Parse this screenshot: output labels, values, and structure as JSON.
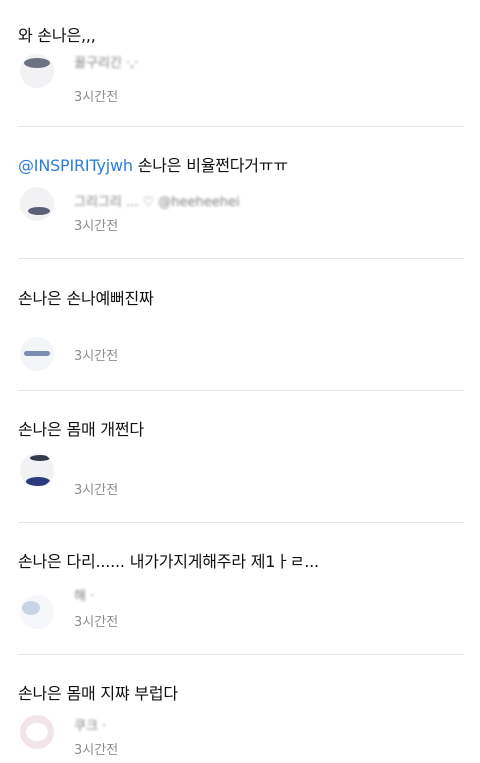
{
  "posts": [
    {
      "body": "와 손나은,,,",
      "username": "꿀구리긴 ·,·",
      "time": "3시간전"
    },
    {
      "mention": "@INSPIRITyjwh",
      "body": "손나은 비율쩐다거ㅠㅠ",
      "username": "그리그리 ... ♡ @heeheehei",
      "time": "3시간전"
    },
    {
      "body": "손나은 손나예뻐진짜",
      "time": "3시간전"
    },
    {
      "body": "손나은 몸매 개쩐다",
      "time": "3시간전"
    },
    {
      "body": "손나은 다리...... 내가가지게해주라 제1ㅏㄹ...",
      "username": "해 ·",
      "time": "3시간전"
    },
    {
      "body": "손나은 몸매 지쨔 부럽다",
      "username": "쿠크 ·",
      "time": "3시간전"
    }
  ]
}
